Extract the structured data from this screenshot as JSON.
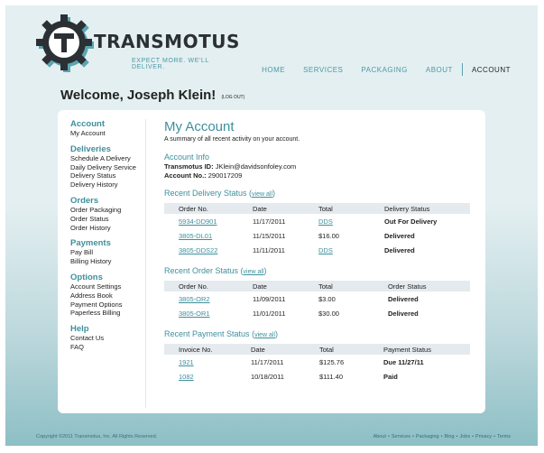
{
  "brand": {
    "name": "TRANSMOTUS",
    "tagline": "EXPECT MORE. WE'LL DELIVER.",
    "accent_color": "#4a9aa6"
  },
  "nav": {
    "items": [
      "HOME",
      "SERVICES",
      "PACKAGING",
      "ABOUT"
    ],
    "active": "ACCOUNT"
  },
  "welcome": {
    "text": "Welcome, Joseph Klein!",
    "logout": "(LOG OUT)"
  },
  "sidebar": [
    {
      "head": "Account",
      "items": [
        "My Account"
      ]
    },
    {
      "head": "Deliveries",
      "items": [
        "Schedule A Delivery",
        "Daily Delivery Service",
        "Delivery Status",
        "Delivery History"
      ]
    },
    {
      "head": "Orders",
      "items": [
        "Order Packaging",
        "Order Status",
        "Order History"
      ]
    },
    {
      "head": "Payments",
      "items": [
        "Pay Bill",
        "Billing History"
      ]
    },
    {
      "head": "Options",
      "items": [
        "Account Settings",
        "Address Book",
        "Payment Options",
        "Paperless Billing"
      ]
    },
    {
      "head": "Help",
      "items": [
        "Contact Us",
        "FAQ"
      ]
    }
  ],
  "main": {
    "title": "My Account",
    "subtitle": "A summary of all recent activity on your account.",
    "account_info": {
      "title": "Account Info",
      "id_label": "Transmotus ID:",
      "id_value": "JKlein@davidsonfoley.com",
      "no_label": "Account No.:",
      "no_value": "290017209"
    },
    "delivery": {
      "title": "Recent Delivery Status",
      "view_all": "view all",
      "columns": [
        "Order No.",
        "Date",
        "Total",
        "Delivery Status"
      ],
      "rows": [
        [
          "5934-DD901",
          "11/17/2011",
          "DDS",
          "Out For Delivery"
        ],
        [
          "3805-DL01",
          "11/15/2011",
          "$16.00",
          "Delivered"
        ],
        [
          "3805-DDS22",
          "11/11/2011",
          "DDS",
          "Delivered"
        ]
      ]
    },
    "orders": {
      "title": "Recent Order Status",
      "view_all": "view all",
      "columns": [
        "Order No.",
        "Date",
        "Total",
        "Order Status"
      ],
      "rows": [
        [
          "3805-OR2",
          "11/09/2011",
          "$3.00",
          "Delivered"
        ],
        [
          "3805-OR1",
          "11/01/2011",
          "$30.00",
          "Delivered"
        ]
      ]
    },
    "payments": {
      "title": "Recent Payment Status",
      "view_all": "view all",
      "columns": [
        "Invoice No.",
        "Date",
        "Total",
        "Payment Status"
      ],
      "rows": [
        [
          "1921",
          "11/17/2011",
          "$125.76",
          "Due 11/27/11"
        ],
        [
          "1082",
          "10/18/2011",
          "$111.40",
          "Paid"
        ]
      ]
    }
  },
  "footer": {
    "copyright": "Copyright ©2011 Transmotus, Inc. All Rights Reserved.",
    "links": [
      "About",
      "Services",
      "Packaging",
      "Blog",
      "Jobs",
      "Privacy",
      "Terms"
    ]
  }
}
